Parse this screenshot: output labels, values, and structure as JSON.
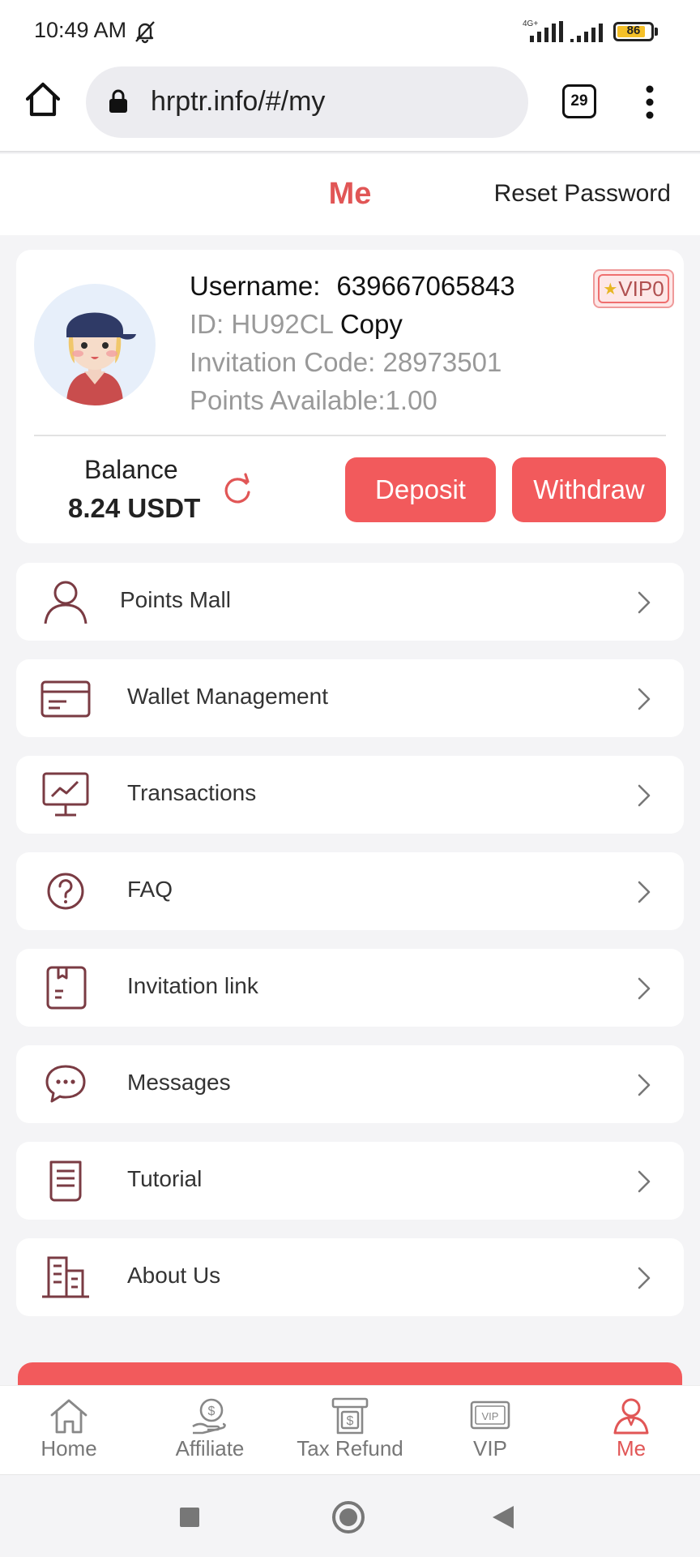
{
  "status_bar": {
    "time": "10:49 AM",
    "network": "4G+",
    "battery": "86",
    "battery_level": 0.86
  },
  "browser": {
    "url": "hrptr.info/#/my",
    "tab_count": "29"
  },
  "header": {
    "title": "Me",
    "reset_password": "Reset Password"
  },
  "profile": {
    "username_label": "Username:",
    "username": "639667065843",
    "id_text": "ID: HU92CL",
    "copy_label": "Copy",
    "invitation_code": "Invitation Code: 28973501",
    "points_available": "Points Available:1.00",
    "vip_level": "VIP0"
  },
  "balance": {
    "label": "Balance",
    "value": "8.24 USDT"
  },
  "actions": {
    "deposit": "Deposit",
    "withdraw": "Withdraw"
  },
  "menu": [
    {
      "label": "Points Mall",
      "icon": "user-icon"
    },
    {
      "label": "Wallet Management",
      "icon": "wallet-card-icon"
    },
    {
      "label": "Transactions",
      "icon": "monitor-chart-icon"
    },
    {
      "label": "FAQ",
      "icon": "question-icon"
    },
    {
      "label": "Invitation link",
      "icon": "invitation-box-icon"
    },
    {
      "label": "Messages",
      "icon": "chat-bubble-icon"
    },
    {
      "label": "Tutorial",
      "icon": "document-icon"
    },
    {
      "label": "About Us",
      "icon": "building-icon"
    }
  ],
  "bottom_nav": [
    {
      "label": "Home",
      "icon": "home-icon",
      "active": false
    },
    {
      "label": "Affiliate",
      "icon": "affiliate-money-hand-icon",
      "active": false
    },
    {
      "label": "Tax Refund",
      "icon": "tax-refund-icon",
      "active": false
    },
    {
      "label": "VIP",
      "icon": "vip-ticket-icon",
      "active": false
    },
    {
      "label": "Me",
      "icon": "person-icon",
      "active": true
    }
  ],
  "colors": {
    "accent": "#f25a5c",
    "title": "#e15656",
    "icon": "#7a3b43"
  }
}
